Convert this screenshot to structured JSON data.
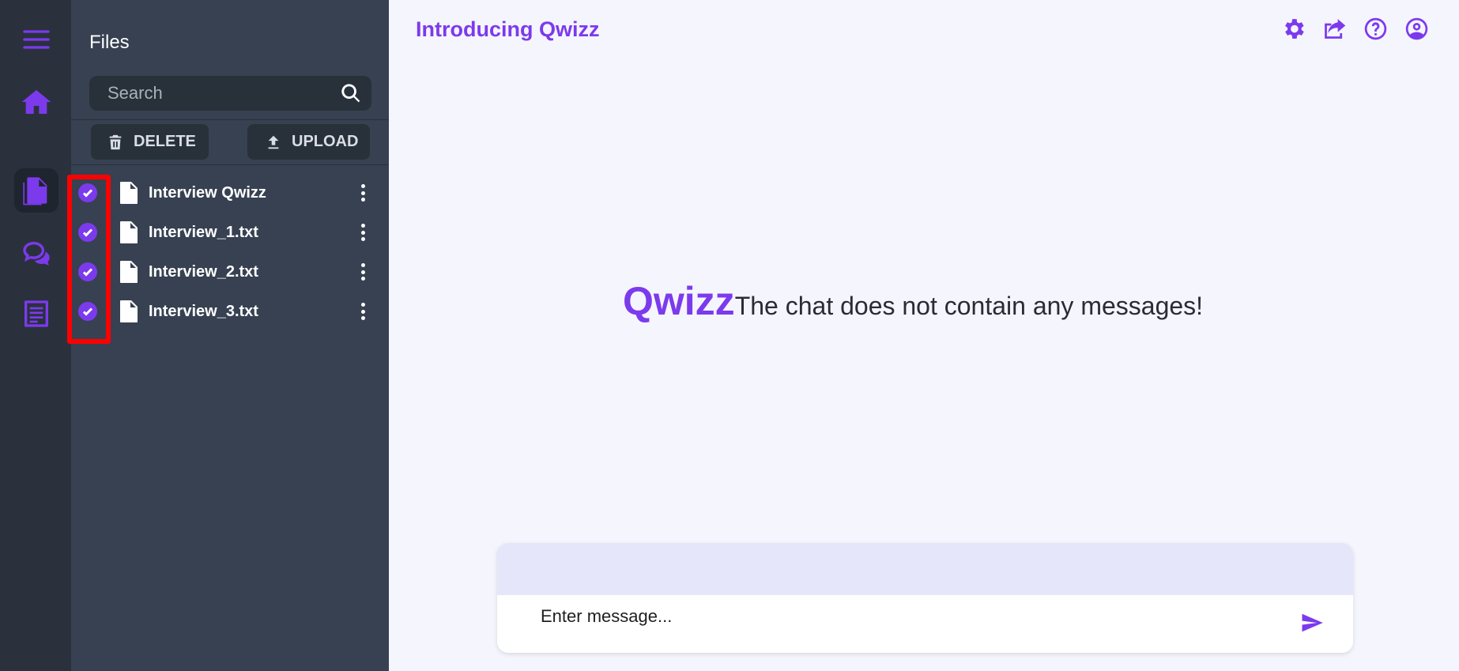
{
  "rail": {
    "items": [
      {
        "icon": "menu-icon"
      },
      {
        "icon": "home-icon"
      },
      {
        "icon": "files-icon",
        "active": true
      },
      {
        "icon": "chat-icon"
      },
      {
        "icon": "notes-icon"
      }
    ]
  },
  "files": {
    "title": "Files",
    "search_placeholder": "Search",
    "delete_label": "DELETE",
    "upload_label": "UPLOAD",
    "items": [
      {
        "name": "Interview Qwizz",
        "checked": true
      },
      {
        "name": "Interview_1.txt",
        "checked": true
      },
      {
        "name": "Interview_2.txt",
        "checked": true
      },
      {
        "name": "Interview_3.txt",
        "checked": true
      }
    ]
  },
  "header": {
    "title": "Introducing Qwizz",
    "icons": [
      "settings-icon",
      "share-icon",
      "help-icon",
      "account-icon"
    ]
  },
  "chat": {
    "brand": "Qwizz",
    "empty_message": "The chat does not contain any messages!",
    "input_placeholder": "Enter message..."
  },
  "colors": {
    "accent": "#7c3aed",
    "rail_bg": "#2a313d",
    "panel_bg": "#374151",
    "main_bg": "#f5f5fd",
    "highlight": "#ff0000"
  }
}
